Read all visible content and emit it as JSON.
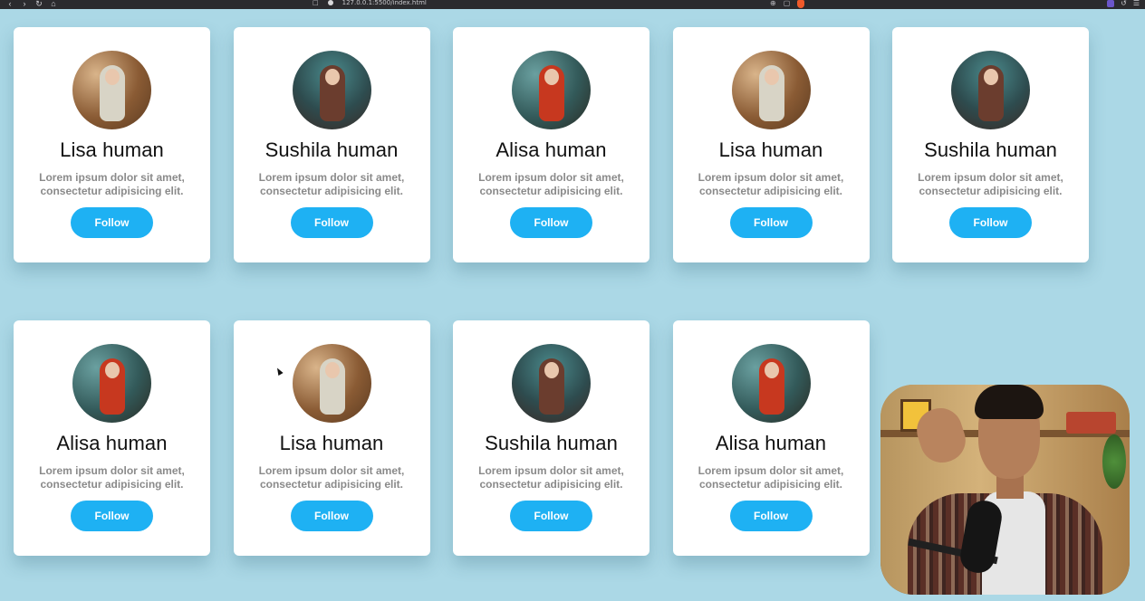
{
  "browser": {
    "url": "127.0.0.1:5500/index.html"
  },
  "cards": [
    {
      "name": "Lisa human",
      "description": "Lorem ipsum dolor sit amet, consectetur adipisicing elit.",
      "follow_label": "Follow",
      "avatar_icon": "avatar-photo-0"
    },
    {
      "name": "Sushila human",
      "description": "Lorem ipsum dolor sit amet, consectetur adipisicing elit.",
      "follow_label": "Follow",
      "avatar_icon": "avatar-photo-1"
    },
    {
      "name": "Alisa human",
      "description": "Lorem ipsum dolor sit amet, consectetur adipisicing elit.",
      "follow_label": "Follow",
      "avatar_icon": "avatar-photo-2"
    },
    {
      "name": "Lisa human",
      "description": "Lorem ipsum dolor sit amet, consectetur adipisicing elit.",
      "follow_label": "Follow",
      "avatar_icon": "avatar-photo-0"
    },
    {
      "name": "Sushila human",
      "description": "Lorem ipsum dolor sit amet, consectetur adipisicing elit.",
      "follow_label": "Follow",
      "avatar_icon": "avatar-photo-1"
    },
    {
      "name": "Alisa human",
      "description": "Lorem ipsum dolor sit amet, consectetur adipisicing elit.",
      "follow_label": "Follow",
      "avatar_icon": "avatar-photo-2"
    },
    {
      "name": "Lisa human",
      "description": "Lorem ipsum dolor sit amet, consectetur adipisicing elit.",
      "follow_label": "Follow",
      "avatar_icon": "avatar-photo-0"
    },
    {
      "name": "Sushila human",
      "description": "Lorem ipsum dolor sit amet, consectetur adipisicing elit.",
      "follow_label": "Follow",
      "avatar_icon": "avatar-photo-1"
    },
    {
      "name": "Alisa human",
      "description": "Lorem ipsum dolor sit amet, consectetur adipisicing elit.",
      "follow_label": "Follow",
      "avatar_icon": "avatar-photo-2"
    }
  ],
  "colors": {
    "page_background": "#abd8e6",
    "card_background": "#ffffff",
    "follow_button": "#1eb1f3",
    "description_text": "#8a8a8a"
  }
}
